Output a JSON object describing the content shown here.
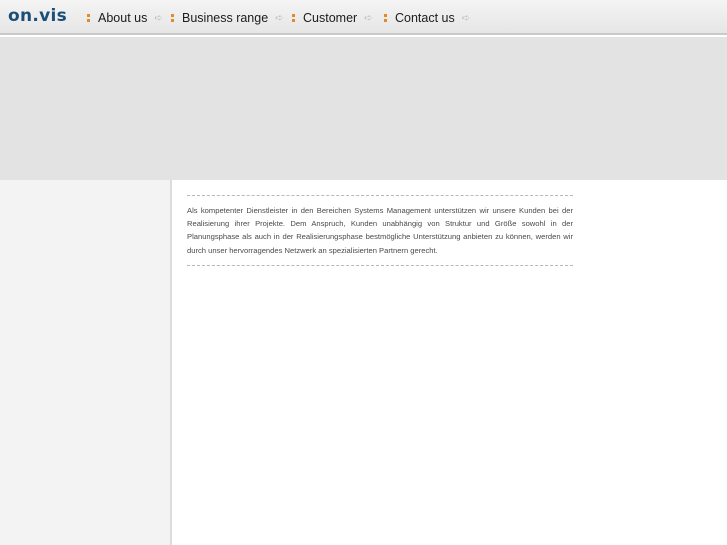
{
  "logo": "on.vis",
  "nav": {
    "items": [
      {
        "label": "About us"
      },
      {
        "label": "Business range"
      },
      {
        "label": "Customer"
      },
      {
        "label": "Contact us"
      }
    ],
    "arrow_glyph": "➪",
    "accent_color": "#e08a2a"
  },
  "content": {
    "paragraph": "Als kompetenter Dienstleister in den Bereichen Systems Management unterstützen wir unsere Kunden bei der Realisierung ihrer Projekte. Dem Anspruch, Kunden unabhängig von Struktur und Größe sowohl in der Planungsphase als auch in der Realisierungsphase bestmögliche Unterstützung anbieten zu können, werden wir durch unser hervorragendes Netzwerk an spezialisierten Partnern gerecht."
  }
}
